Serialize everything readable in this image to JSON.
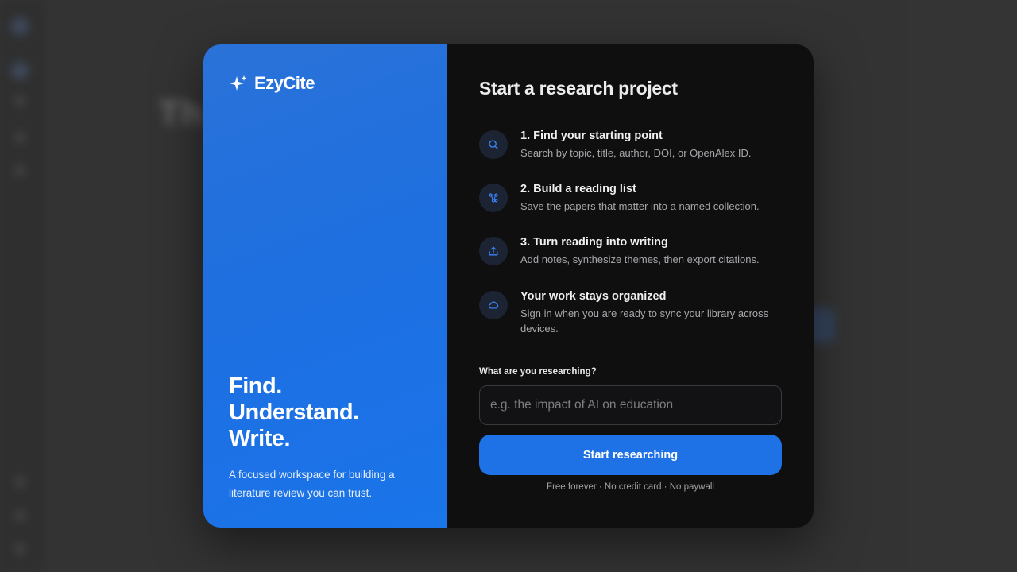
{
  "background": {
    "title": "Th                                         nager"
  },
  "brand": {
    "name": "EzyCite",
    "icon": "sparkle-icon"
  },
  "hero": {
    "lines": [
      "Find.",
      "Understand.",
      "Write."
    ],
    "blurb": "A focused workspace for building a literature review you can trust."
  },
  "panel": {
    "heading": "Start a research project",
    "steps": [
      {
        "icon": "search-icon",
        "title": "1. Find your starting point",
        "desc": "Search by topic, title, author, DOI, or OpenAlex ID."
      },
      {
        "icon": "network-icon",
        "title": "2. Build a reading list",
        "desc": "Save the papers that matter into a named collection."
      },
      {
        "icon": "upload-icon",
        "title": "3. Turn reading into writing",
        "desc": "Add notes, synthesize themes, then export citations."
      },
      {
        "icon": "cloud-icon",
        "title": "Your work stays organized",
        "desc": "Sign in when you are ready to sync your library across devices."
      }
    ]
  },
  "form": {
    "label": "What are you researching?",
    "placeholder": "e.g. the impact of AI on education",
    "value": "",
    "submit_label": "Start researching",
    "fineprint": "Free forever · No credit card · No paywall"
  },
  "colors": {
    "accent": "#1f72e6",
    "panel_dark": "#0f0f10",
    "icon_blue": "#3b82f6"
  }
}
